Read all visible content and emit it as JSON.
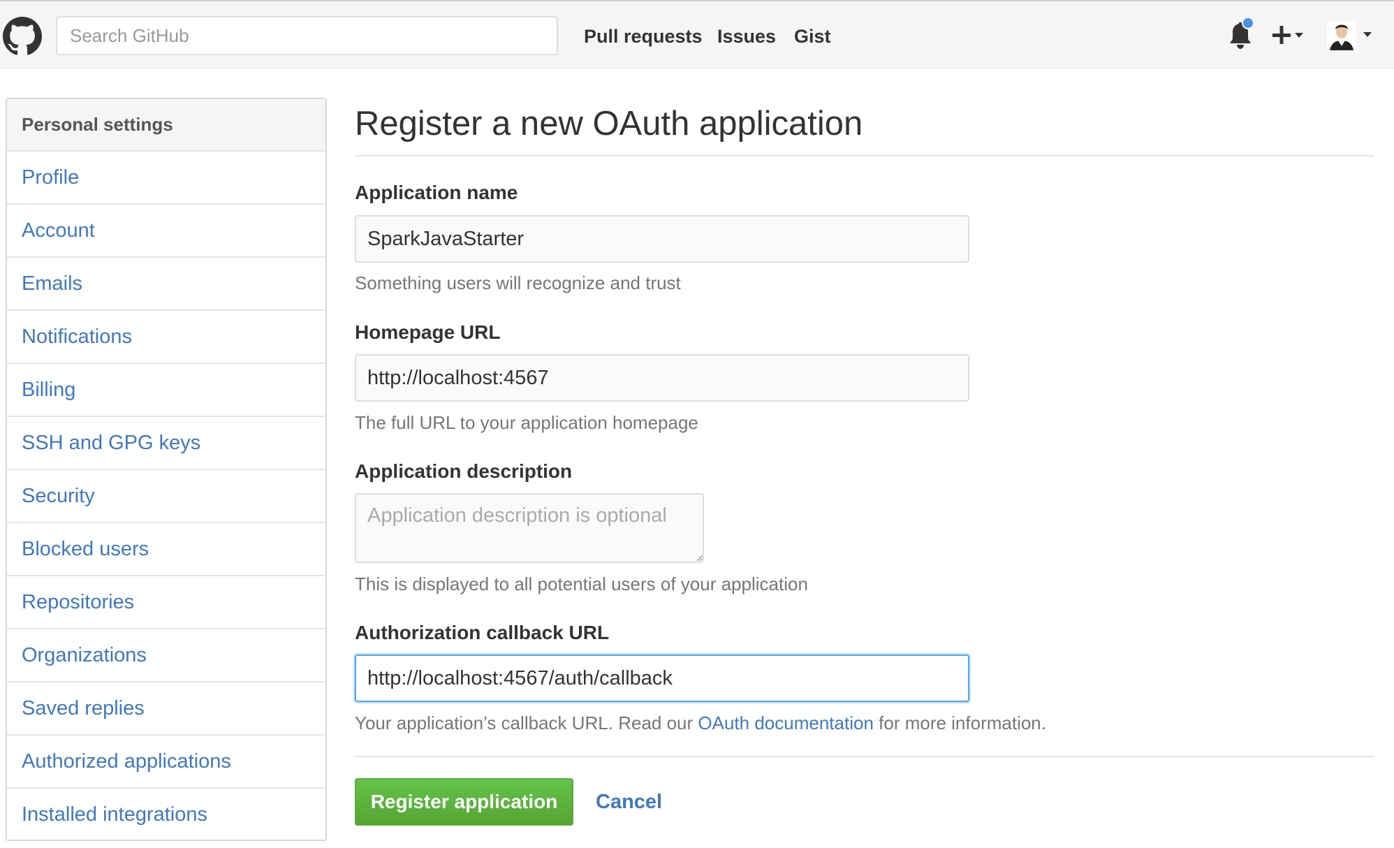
{
  "header": {
    "logo_icon": "github-mark-icon",
    "search_placeholder": "Search GitHub",
    "nav": [
      "Pull requests",
      "Issues",
      "Gist"
    ],
    "notification_icon": "bell-icon",
    "new_icon": "plus-icon",
    "avatar_icon": "avatar-icon",
    "notification_dot_color": "#4a90e2"
  },
  "sidebar": {
    "title": "Personal settings",
    "items": [
      "Profile",
      "Account",
      "Emails",
      "Notifications",
      "Billing",
      "SSH and GPG keys",
      "Security",
      "Blocked users",
      "Repositories",
      "Organizations",
      "Saved replies",
      "Authorized applications",
      "Installed integrations"
    ]
  },
  "main": {
    "title": "Register a new OAuth application",
    "app_name": {
      "label": "Application name",
      "value": "SparkJavaStarter",
      "note": "Something users will recognize and trust"
    },
    "homepage": {
      "label": "Homepage URL",
      "value": "http://localhost:4567",
      "note": "The full URL to your application homepage"
    },
    "description": {
      "label": "Application description",
      "placeholder": "Application description is optional",
      "note": "This is displayed to all potential users of your application"
    },
    "callback": {
      "label": "Authorization callback URL",
      "value": "http://localhost:4567/auth/callback",
      "note_before": "Your application’s callback URL. Read our ",
      "note_link": "OAuth documentation",
      "note_after": " for more information."
    },
    "register_button": "Register application",
    "cancel_link": "Cancel"
  },
  "colors": {
    "link": "#4078c0",
    "primary_button": "#55a532",
    "focus_border": "#51a7e8"
  }
}
